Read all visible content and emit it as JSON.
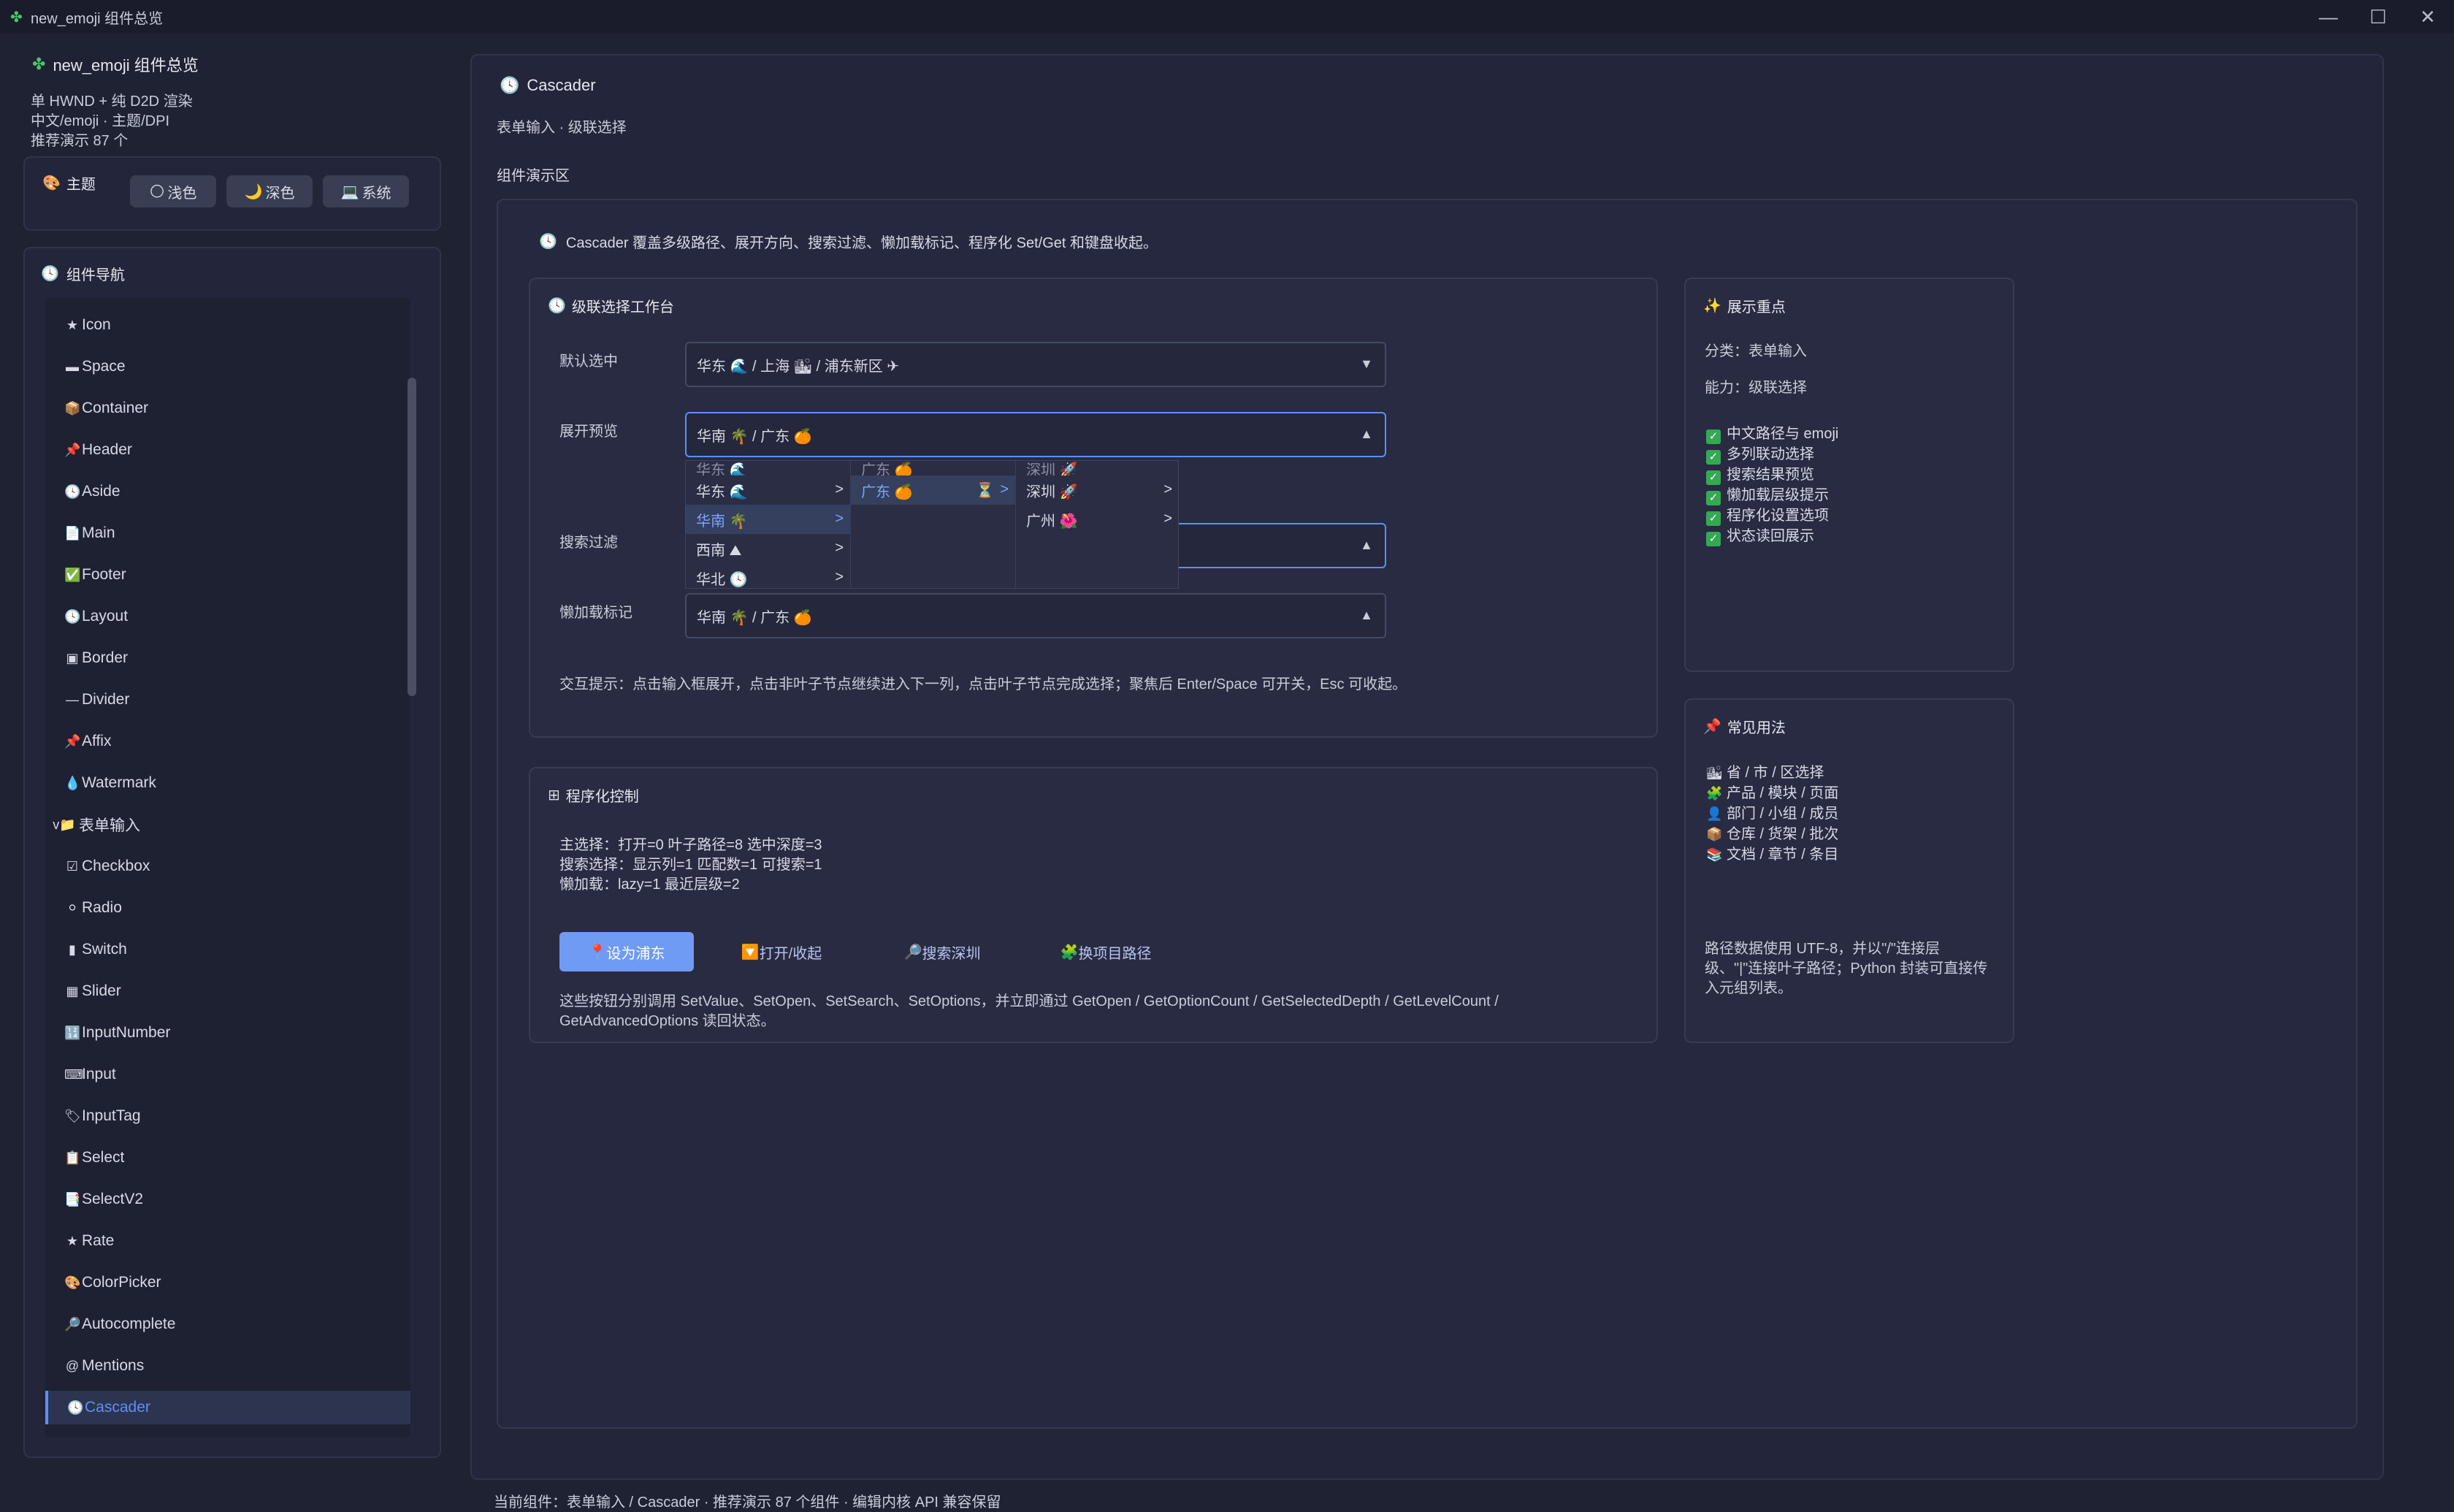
{
  "window": {
    "title": "new_emoji 组件总览",
    "min": "—",
    "max": "☐",
    "close": "✕"
  },
  "sidebar": {
    "title": "new_emoji 组件总览",
    "info": [
      "单 HWND + 纯 D2D 渲染",
      "中文/emoji · 主题/DPI",
      "推荐演示 87 个"
    ],
    "theme": {
      "label": "主题",
      "buttons": [
        {
          "icon": "🌕",
          "label": "浅色"
        },
        {
          "icon": "🌙",
          "label": "深色"
        },
        {
          "icon": "💻",
          "label": "系统"
        }
      ]
    },
    "nav": {
      "title": "组件导航",
      "items": [
        {
          "icon": "★",
          "label": "Icon"
        },
        {
          "icon": "▬",
          "label": "Space"
        },
        {
          "icon": "📦",
          "label": "Container"
        },
        {
          "icon": "📌",
          "label": "Header"
        },
        {
          "icon": "🕓",
          "label": "Aside"
        },
        {
          "icon": "📄",
          "label": "Main"
        },
        {
          "icon": "✅",
          "label": "Footer"
        },
        {
          "icon": "🕓",
          "label": "Layout"
        },
        {
          "icon": "▣",
          "label": "Border"
        },
        {
          "icon": "—",
          "label": "Divider"
        },
        {
          "icon": "📌",
          "label": "Affix"
        },
        {
          "icon": "💧",
          "label": "Watermark"
        },
        {
          "icon": "v📁",
          "label": "表单输入"
        },
        {
          "icon": "☑",
          "label": "Checkbox"
        },
        {
          "icon": "⚪",
          "label": "Radio"
        },
        {
          "icon": "▮",
          "label": "Switch"
        },
        {
          "icon": "▦",
          "label": "Slider"
        },
        {
          "icon": "🔢",
          "label": "InputNumber"
        },
        {
          "icon": "⌨",
          "label": "Input"
        },
        {
          "icon": "🏷",
          "label": "InputTag"
        },
        {
          "icon": "📋",
          "label": "Select"
        },
        {
          "icon": "📑",
          "label": "SelectV2"
        },
        {
          "icon": "★",
          "label": "Rate"
        },
        {
          "icon": "🎨",
          "label": "ColorPicker"
        },
        {
          "icon": "🔎",
          "label": "Autocomplete"
        },
        {
          "icon": "@",
          "label": "Mentions"
        },
        {
          "icon": "🕓",
          "label": "Cascader"
        }
      ]
    }
  },
  "main": {
    "title": "Cascader",
    "subtitle": "表单输入 · 级联选择",
    "demo_label": "组件演示区",
    "intro": "Cascader 覆盖多级路径、展开方向、搜索过滤、懒加载标记、程序化 Set/Get 和键盘收起。",
    "workbench": {
      "title": "级联选择工作台",
      "rows": [
        {
          "label": "默认选中",
          "value": "华东 🌊 / 上海 🏙 / 浦东新区 ✈",
          "arrow": "▼"
        },
        {
          "label": "展开预览",
          "value": "华南 🌴 / 广东 🍊",
          "arrow": "▲"
        },
        {
          "label": "搜索过滤",
          "value": "",
          "arrow": "▲"
        },
        {
          "label": "懒加载标记",
          "value": "华南 🌴 / 广东 🍊",
          "arrow": "▲"
        }
      ],
      "dropdown": {
        "col1": [
          "华东 🌊",
          "华南 🌴",
          "西南 ⛰",
          "华北 🕓"
        ],
        "col2": [
          "广东 🍊"
        ],
        "col2_lazy": "⏳",
        "col3": [
          "深圳 🚀",
          "广州 🌺"
        ],
        "gt": ">"
      },
      "hint": "交互提示：点击输入框展开，点击非叶子节点继续进入下一列，点击叶子节点完成选择；聚焦后 Enter/Space 可开关，Esc 可收起。"
    },
    "programmatic": {
      "title": "程序化控制",
      "status": [
        "主选择：打开=0 叶子路径=8 选中深度=3",
        "搜索选择：显示列=1 匹配数=1 可搜索=1",
        "懒加载：lazy=1 最近层级=2"
      ],
      "buttons": [
        {
          "icon": "📍",
          "label": "设为浦东"
        },
        {
          "icon": "🔽",
          "label": "打开/收起"
        },
        {
          "icon": "🔎",
          "label": "搜索深圳"
        },
        {
          "icon": "🧩",
          "label": "换项目路径"
        }
      ],
      "note": "这些按钮分别调用 SetValue、SetOpen、SetSearch、SetOptions，并立即通过 GetOpen / GetOptionCount / GetSelectedDepth / GetLevelCount / GetAdvancedOptions 读回状态。"
    },
    "highlights": {
      "title": "展示重点",
      "category": "分类：表单输入",
      "ability": "能力：级联选择",
      "checks": [
        "中文路径与 emoji",
        "多列联动选择",
        "搜索结果预览",
        "懒加载层级提示",
        "程序化设置选项",
        "状态读回展示"
      ]
    },
    "usage": {
      "title": "常见用法",
      "items": [
        {
          "icon": "🏙",
          "label": "省 / 市 / 区选择"
        },
        {
          "icon": "🧩",
          "label": "产品 / 模块 / 页面"
        },
        {
          "icon": "👤",
          "label": "部门 / 小组 / 成员"
        },
        {
          "icon": "📦",
          "label": "仓库 / 货架 / 批次"
        },
        {
          "icon": "📚",
          "label": "文档 / 章节 / 条目"
        }
      ],
      "note": "路径数据使用 UTF-8，并以\"/\"连接层级、\"|\"连接叶子路径；Python 封装可直接传入元组列表。"
    }
  },
  "status_bar": "当前组件：表单输入 / Cascader · 推荐演示 87 个组件 · 编辑内核 API 兼容保留",
  "colors": {
    "accent": "#5b8ff9",
    "primary_button": "#6f9bf5",
    "check": "#35a853",
    "background": "#1f2233"
  }
}
